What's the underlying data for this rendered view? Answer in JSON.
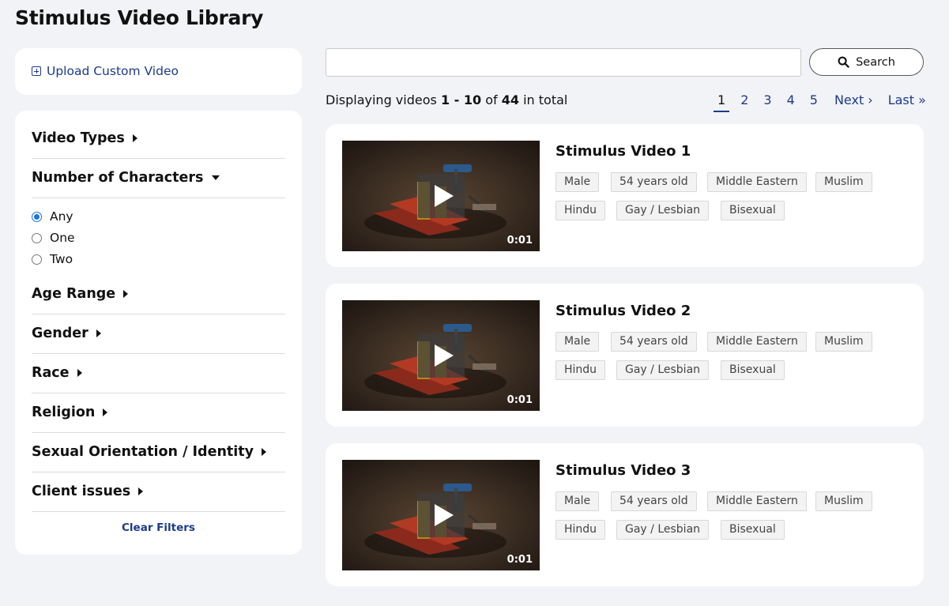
{
  "page_title": "Stimulus Video Library",
  "upload": {
    "label": "Upload Custom Video",
    "icon": "plus-box-icon"
  },
  "filters": {
    "video_types": "Video Types",
    "num_characters": "Number of Characters",
    "num_options": [
      "Any",
      "One",
      "Two"
    ],
    "num_selected": "Any",
    "age_range": "Age Range",
    "gender": "Gender",
    "race": "Race",
    "religion": "Religion",
    "orientation": "Sexual Orientation / Identity",
    "client_issues": "Client issues",
    "clear": "Clear Filters"
  },
  "search": {
    "value": "",
    "placeholder": "",
    "button": "Search"
  },
  "results": {
    "prefix": "Displaying videos",
    "range": "1 - 10",
    "of": "of",
    "total": "44",
    "suffix": "in total"
  },
  "pagination": {
    "pages": [
      "1",
      "2",
      "3",
      "4",
      "5"
    ],
    "current": "1",
    "next": "Next ›",
    "last": "Last »"
  },
  "videos": [
    {
      "title": "Stimulus Video 1",
      "duration": "0:01",
      "tags_row1": [
        "Male",
        "54 years old",
        "Middle Eastern",
        "Muslim"
      ],
      "tags_row2": [
        "Hindu",
        "Gay / Lesbian",
        "Bisexual"
      ]
    },
    {
      "title": "Stimulus Video 2",
      "duration": "0:01",
      "tags_row1": [
        "Male",
        "54 years old",
        "Middle Eastern",
        "Muslim"
      ],
      "tags_row2": [
        "Hindu",
        "Gay / Lesbian",
        "Bisexual"
      ]
    },
    {
      "title": "Stimulus Video 3",
      "duration": "0:01",
      "tags_row1": [
        "Male",
        "54 years old",
        "Middle Eastern",
        "Muslim"
      ],
      "tags_row2": [
        "Hindu",
        "Gay / Lesbian",
        "Bisexual"
      ]
    }
  ],
  "colors": {
    "link": "#1e3a8a",
    "background": "#f1f3f7",
    "radio_accent": "#1a73e8"
  }
}
